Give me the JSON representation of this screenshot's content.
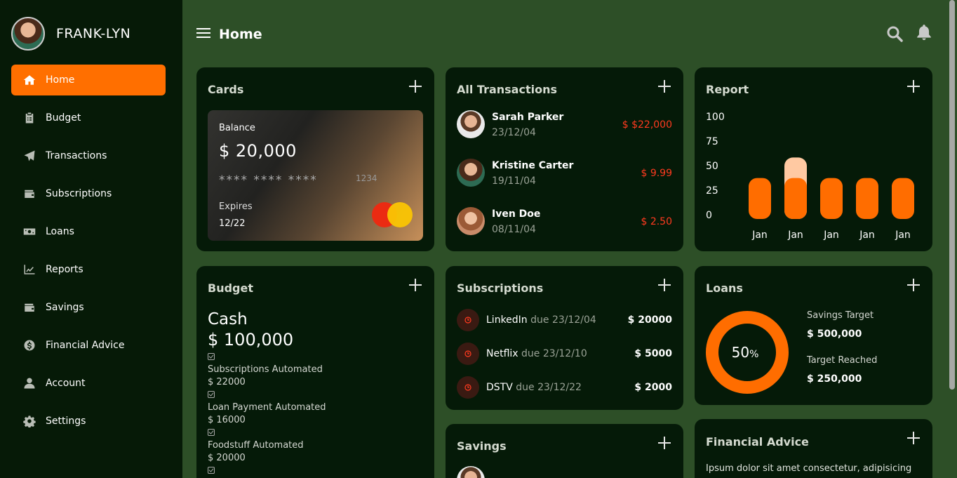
{
  "user": {
    "name": "FRANK-LYN"
  },
  "nav": [
    {
      "label": "Home",
      "icon": "home-icon",
      "active": true
    },
    {
      "label": "Budget",
      "icon": "clipboard-icon"
    },
    {
      "label": "Transactions",
      "icon": "paper-plane-icon"
    },
    {
      "label": "Subscriptions",
      "icon": "wallet-icon"
    },
    {
      "label": "Loans",
      "icon": "money-bill-icon"
    },
    {
      "label": "Reports",
      "icon": "chart-line-icon"
    },
    {
      "label": "Savings",
      "icon": "wallet-icon"
    },
    {
      "label": "Financial Advice",
      "icon": "dollar-circle-icon"
    },
    {
      "label": "Account",
      "icon": "user-icon"
    },
    {
      "label": "Settings",
      "icon": "gear-icon"
    }
  ],
  "header": {
    "title": "Home"
  },
  "cards": {
    "title": "Cards",
    "balance_label": "Balance",
    "balance": "$ 20,000",
    "masked_number": "**** **** ****",
    "last_four": "1234",
    "expires_label": "Expires",
    "expires": "12/22"
  },
  "transactions": {
    "title": "All Transactions",
    "items": [
      {
        "name": "Sarah Parker",
        "date": "23/12/04",
        "amount": "$ $22,000"
      },
      {
        "name": "Kristine Carter",
        "date": "19/11/04",
        "amount": "$ 9.99"
      },
      {
        "name": "Iven Doe",
        "date": "08/11/04",
        "amount": "$ 2.50"
      }
    ]
  },
  "report": {
    "title": "Report",
    "chart_data": {
      "type": "bar",
      "categories": [
        "Jan",
        "Jan",
        "Jan",
        "Jan",
        "Jan"
      ],
      "series": [
        {
          "values": [
            40,
            40,
            40,
            40,
            40
          ]
        },
        {
          "values": [
            0,
            20,
            0,
            0,
            0
          ]
        }
      ],
      "y_ticks": [
        "100",
        "75",
        "50",
        "25",
        "0"
      ],
      "stacked": true,
      "colors": [
        "#ff6d00",
        "#ffc9a2"
      ]
    }
  },
  "budget": {
    "title": "Budget",
    "cash_label": "Cash",
    "total": "$ 100,000",
    "items": [
      {
        "label": "Subscriptions Automated",
        "amount": "$ 22000"
      },
      {
        "label": "Loan Payment Automated",
        "amount": "$ 16000"
      },
      {
        "label": "Foodstuff Automated",
        "amount": "$ 20000"
      }
    ]
  },
  "subscriptions": {
    "title": "Subscriptions",
    "items": [
      {
        "name": "LinkedIn",
        "due": "due 23/12/04",
        "amount": "$ 20000"
      },
      {
        "name": "Netflix",
        "due": "due 23/12/10",
        "amount": "$ 5000"
      },
      {
        "name": "DSTV",
        "due": "due 23/12/22",
        "amount": "$ 2000"
      }
    ]
  },
  "loans": {
    "title": "Loans",
    "percent_value": "50",
    "percent_sign": "%",
    "progress": 0.5,
    "savings_target_label": "Savings Target",
    "savings_target": "$ 500,000",
    "target_reached_label": "Target Reached",
    "target_reached": "$ 250,000"
  },
  "savings": {
    "title": "Savings"
  },
  "financial_advice": {
    "title": "Financial Advice",
    "text": "Ipsum dolor sit amet consectetur, adipisicing"
  },
  "colors": {
    "accent": "#ff6f00",
    "background": "#2d4f27",
    "card": "#051a08",
    "negative": "#ff3a1f"
  }
}
